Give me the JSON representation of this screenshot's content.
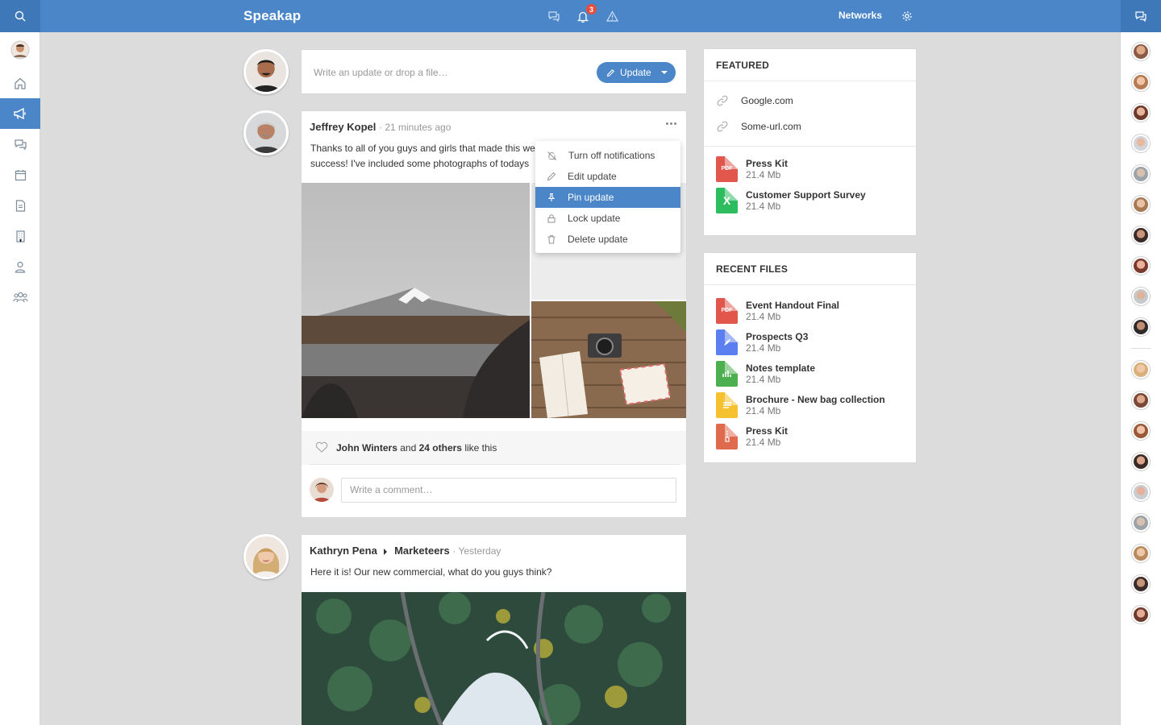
{
  "app": {
    "brand": "Speakap",
    "networks_label": "Networks",
    "notification_count": "3"
  },
  "composer": {
    "placeholder": "Write an update or drop a file…",
    "update_label": "Update"
  },
  "posts": [
    {
      "author": "Jeffrey Kopel",
      "time": "· 21 minutes ago",
      "text_line1": "Thanks to all of you guys and girls that made this we",
      "text_line2": "success! I've included some photographs of todays",
      "likes_name": "John Winters",
      "likes_and": "and",
      "likes_others": "24 others",
      "likes_suffix": "like this",
      "comment_placeholder": "Write a comment…"
    },
    {
      "author": "Kathryn Pena",
      "group": "Marketeers",
      "time": "· Yesterday",
      "text": "Here it is! Our new commercial, what do you guys think?"
    }
  ],
  "context_menu": {
    "items": [
      {
        "label": "Turn off notifications",
        "icon": "bell-off-icon"
      },
      {
        "label": "Edit update",
        "icon": "pencil-icon"
      },
      {
        "label": "Pin update",
        "icon": "pin-icon",
        "active": true
      },
      {
        "label": "Lock update",
        "icon": "lock-icon"
      },
      {
        "label": "Delete update",
        "icon": "trash-icon"
      }
    ]
  },
  "featured": {
    "title": "FEATURED",
    "links": [
      "Google.com",
      "Some-url.com"
    ],
    "files": [
      {
        "name": "Press Kit",
        "size": "21.4 Mb",
        "type": "pdf",
        "badge": "PDF",
        "color": "#e2574c"
      },
      {
        "name": "Customer Support Survey",
        "size": "21.4 Mb",
        "type": "sheet",
        "badge": "X",
        "color": "#2dbd5f"
      }
    ]
  },
  "recent_files": {
    "title": "RECENT FILES",
    "files": [
      {
        "name": "Event Handout Final",
        "size": "21.4 Mb",
        "type": "pdf",
        "badge": "PDF",
        "color": "#e2574c"
      },
      {
        "name": "Prospects Q3",
        "size": "21.4 Mb",
        "type": "drawing",
        "color": "#5b7ef0"
      },
      {
        "name": "Notes template",
        "size": "21.4 Mb",
        "type": "chart",
        "color": "#4caf50"
      },
      {
        "name": "Brochure - New bag collection",
        "size": "21.4 Mb",
        "type": "doc",
        "color": "#f5c12e"
      },
      {
        "name": "Press Kit",
        "size": "21.4 Mb",
        "type": "archive",
        "color": "#e06a4e"
      }
    ]
  },
  "colors": {
    "accent": "#4a86c8",
    "background": "#dcdcdc"
  }
}
